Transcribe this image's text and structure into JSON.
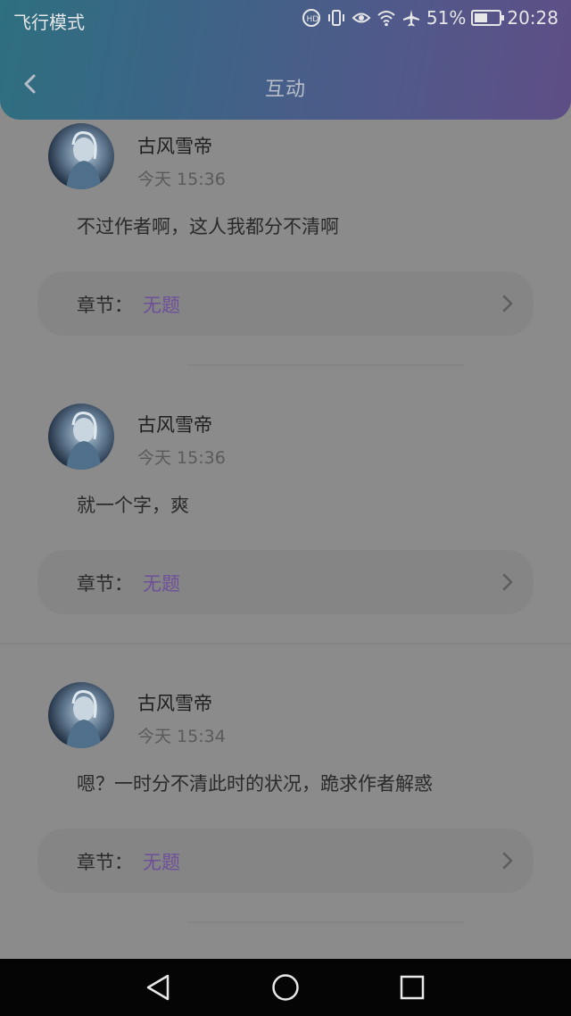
{
  "status_bar": {
    "carrier_text": "飞行模式",
    "battery_percent": "51%",
    "time": "20:28",
    "icons": [
      "hd-call-icon",
      "vibrate-icon",
      "eye-care-icon",
      "wifi-icon",
      "airplane-icon",
      "battery-icon"
    ]
  },
  "header": {
    "title": "互动",
    "back_icon": "chevron-left-icon",
    "gradient_colors": [
      "#2e6f80",
      "#5e4e86"
    ]
  },
  "comments": [
    {
      "user": "古风雪帝",
      "time": "今天 15:36",
      "text": "不过作者啊，这人我都分不清啊",
      "chapter_label": "章节：",
      "chapter_value": "无题"
    },
    {
      "user": "古风雪帝",
      "time": "今天 15:36",
      "text": "就一个字，爽",
      "chapter_label": "章节：",
      "chapter_value": "无题"
    },
    {
      "user": "古风雪帝",
      "time": "今天 15:34",
      "text": "嗯？一时分不清此时的状况，跪求作者解惑",
      "chapter_label": "章节：",
      "chapter_value": "无题"
    }
  ],
  "nav_bar": {
    "icons": [
      "back-triangle-icon",
      "home-circle-icon",
      "recents-square-icon"
    ]
  },
  "colors": {
    "chapter_accent": "#6e4f9a",
    "overlay_bg": "#8b8b8b"
  }
}
